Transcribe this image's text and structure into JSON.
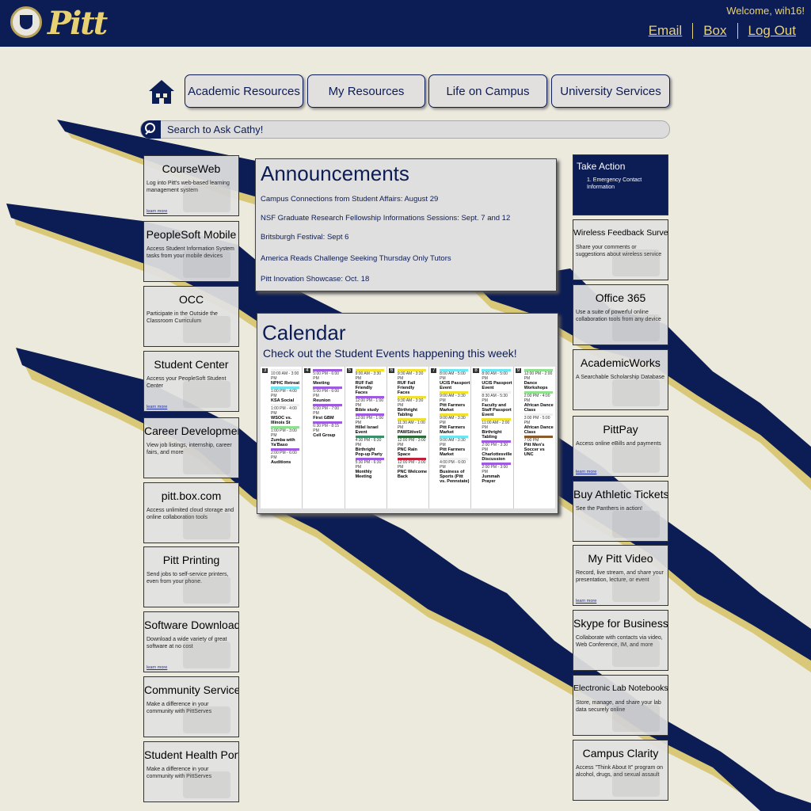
{
  "header": {
    "logo": "Pitt",
    "welcome": "Welcome, wih16!",
    "links": [
      "Email",
      "Box",
      "Log Out"
    ]
  },
  "nav": {
    "tabs": [
      "Academic Resources",
      "My Resources",
      "Life on Campus",
      "University Services"
    ]
  },
  "search": {
    "placeholder": "Search to Ask Cathy!"
  },
  "left_tiles": [
    {
      "title": "CourseWeb",
      "desc": "Log into Pitt's web-based learning management system",
      "more": "learn more"
    },
    {
      "title": "PeopleSoft Mobile",
      "desc": "Access Student Information System tasks from your mobile devices",
      "more": ""
    },
    {
      "title": "OCC",
      "desc": "Participate in the Outside the Classroom Curriculum",
      "more": ""
    },
    {
      "title": "Student Center",
      "desc": "Access your PeopleSoft Student Center",
      "more": "learn more"
    },
    {
      "title": "Career Development",
      "desc": "View job listings, internship, career fairs, and more",
      "more": ""
    },
    {
      "title": "pitt.box.com",
      "desc": "Access unlimited cloud storage and online collaboration tools",
      "more": ""
    },
    {
      "title": "Pitt Printing",
      "desc": "Send jobs to self-service printers, even from your phone.",
      "more": ""
    },
    {
      "title": "Software Download Service",
      "desc": "Download a wide variety of great software at no cost",
      "more": "learn more"
    },
    {
      "title": "Community Service",
      "desc": "Make a difference in your community with PittServes",
      "more": ""
    },
    {
      "title": "Student Health Portal",
      "desc": "Make a difference in your community with PittServes",
      "more": ""
    }
  ],
  "take_action": {
    "title": "Take Action",
    "item": "1. Emergency Contact Information"
  },
  "right_tiles": [
    {
      "title": "Wireless Feedback Survey",
      "desc": "Share your comments or suggestions about wireless service",
      "more": ""
    },
    {
      "title": "Office 365",
      "desc": "Use a suite of powerful online collaboration tools from any device",
      "more": ""
    },
    {
      "title": "AcademicWorks",
      "desc": "A Searchable Scholarship Database",
      "more": ""
    },
    {
      "title": "PittPay",
      "desc": "Access online eBills and payments",
      "more": "learn more"
    },
    {
      "title": "Buy Athletic Tickets",
      "desc": "See the Panthers in action!",
      "more": ""
    },
    {
      "title": "My Pitt Video",
      "desc": "Record, live stream, and share your presentation, lecture, or event",
      "more": "learn more"
    },
    {
      "title": "Skype for Business",
      "desc": "Collaborate with contacts via video, Web Conference, IM, and more",
      "more": ""
    },
    {
      "title": "Electronic Lab Notebooks",
      "desc": "Store, manage, and share your lab data securely online",
      "more": ""
    },
    {
      "title": "Campus Clarity",
      "desc": "Access \"Think About It\" program on alcohol, drugs, and sexual assault",
      "more": ""
    }
  ],
  "announcements": {
    "title": "Announcements",
    "items": [
      "Campus Connections from Student Affairs: August 29",
      "NSF Graduate Research Fellowship Informations Sessions: Sept. 7 and 12",
      "Britsburgh Festival: Sept 6",
      "America Reads Challenge Seeking Thursday Only Tutors",
      "Pitt Inovation Showcase: Oct. 18"
    ]
  },
  "calendar": {
    "title": "Calendar",
    "subtitle": "Check out the Student Events happening this week!",
    "days": [
      {
        "num": "3",
        "events": [
          {
            "time": "10:00 AM - 3:00 PM",
            "name": "NPHC Retreat",
            "color": "#f0f0f0"
          },
          {
            "time": "1:00 PM - 4:00 PM",
            "name": "KSA Social",
            "color": "#6ee5f0"
          },
          {
            "time": "1:00 PM - 4:00 PM",
            "name": "WSOC vs. Illinois St",
            "color": "#f0f0f0"
          },
          {
            "time": "1:00 PM - 3:00 PM",
            "name": "Zumba with Ya'Baso",
            "color": "#8fe08f"
          },
          {
            "time": "2:00 PM - 6:00 PM",
            "name": "Auditions",
            "color": "#a05ae0"
          }
        ]
      },
      {
        "num": "4",
        "events": [
          {
            "time": "5:00 PM - 6:00 PM",
            "name": "Meeting",
            "color": "#a05ae0"
          },
          {
            "time": "5:00 PM - 6:00 PM",
            "name": "Reunion",
            "color": "#a05ae0"
          },
          {
            "time": "6:00 PM - 7:00 PM",
            "name": "First GBM",
            "color": "#a05ae0"
          },
          {
            "time": "6:30 PM - 8:15 PM",
            "name": "Cell Group",
            "color": "#a05ae0"
          }
        ]
      },
      {
        "num": "5",
        "events": [
          {
            "time": "9:00 AM - 3:30 PM",
            "name": "RUF Fall Friendly Faces",
            "color": "#f0e030"
          },
          {
            "time": "12:00 PM - 1:00 PM",
            "name": "Bible study",
            "color": "#a05ae0"
          },
          {
            "time": "12:00 PM - 1:00 PM",
            "name": "Hillel Israel Event",
            "color": "#a05ae0"
          },
          {
            "time": "4:30 PM - 6:30 PM",
            "name": "Birthright Pop-up Party",
            "color": "#3a8f6a"
          },
          {
            "time": "5:30 PM - 6:30 PM",
            "name": "Monthly Meeting",
            "color": "#a05ae0"
          }
        ]
      },
      {
        "num": "6",
        "events": [
          {
            "time": "9:30 AM - 3:30 PM",
            "name": "RUF Fall Friendly Faces",
            "color": "#f0e030"
          },
          {
            "time": "9:30 AM - 3:30 PM",
            "name": "Birthright Tabling",
            "color": "#f0e030"
          },
          {
            "time": "11:30 AM - 1:00 PM",
            "name": "PAWSitiveU",
            "color": "#f0e030"
          },
          {
            "time": "12:00 PM - 3:00 PM",
            "name": "PNC Rain Space",
            "color": "#2a6e3a"
          },
          {
            "time": "12:00 PM - 3:00 PM",
            "name": "PNC Welcome Back",
            "color": "#c0203a"
          }
        ]
      },
      {
        "num": "7",
        "events": [
          {
            "time": "8:00 AM - 5:00 PM",
            "name": "UCIS Passport Event",
            "color": "#6ee5f0"
          },
          {
            "time": "9:00 AM - 3:30 PM",
            "name": "Pitt Farmers Market",
            "color": "#f0e030"
          },
          {
            "time": "9:00 AM - 3:30 PM",
            "name": "Pitt Farmers Market",
            "color": "#f0e030"
          },
          {
            "time": "9:00 AM - 3:30 PM",
            "name": "Pitt Farmers Market",
            "color": "#6ee5f0"
          },
          {
            "time": "4:00 PM - 6:00 PM",
            "name": "Business of Sports (Pitt vs. Pennstate)",
            "color": "#f0f0f0"
          }
        ]
      },
      {
        "num": "8",
        "events": [
          {
            "time": "8:00 AM - 5:00 PM",
            "name": "UCIS Passport Event",
            "color": "#6ee5f0"
          },
          {
            "time": "8:30 AM - 5:30 PM",
            "name": "Faculty and Staff Passport Event",
            "color": "#f0f0f0"
          },
          {
            "time": "11:00 AM - 2:00 PM",
            "name": "Birthright Tabling",
            "color": "#f0e030"
          },
          {
            "time": "2:00 PM - 3:30 PM",
            "name": "Charlottesville Discussion",
            "color": "#a05ae0"
          },
          {
            "time": "2:00 PM - 3:00 PM",
            "name": "Jummah Prayer",
            "color": "#a05ae0"
          }
        ]
      },
      {
        "num": "9",
        "events": [
          {
            "time": "12:00 PM - 2:00 PM",
            "name": "Dance Workshops",
            "color": "#8fe08f"
          },
          {
            "time": "2:00 PM - 4:00 PM",
            "name": "African Dance Class",
            "color": "#8fe08f"
          },
          {
            "time": "3:00 PM - 5:00 PM",
            "name": "African Dance Class",
            "color": "#f0f0f0"
          },
          {
            "time": "7:00 PM",
            "name": "Pitt Men's Soccer vs UNC",
            "color": "#8a5a2a"
          }
        ]
      }
    ]
  },
  "colors": {
    "navy": "#0c1c55",
    "gold": "#e8d173"
  }
}
